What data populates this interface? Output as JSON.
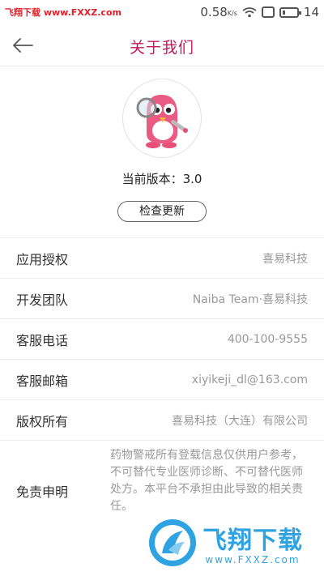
{
  "status_bar": {
    "watermark": "飞翔下载 www.FXXZ.com",
    "speed_value": "0.58",
    "speed_unit": "K/s",
    "time": "14"
  },
  "header": {
    "title": "关于我们"
  },
  "profile": {
    "version_text": "当前版本：3.0",
    "update_button": "检查更新"
  },
  "info": [
    {
      "label": "应用授权",
      "value": "喜易科技"
    },
    {
      "label": "开发团队",
      "value": "Naiba Team·喜易科技"
    },
    {
      "label": "客服电话",
      "value": "400-100-9555"
    },
    {
      "label": "客服邮箱",
      "value": "xiyikeji_dl@163.com"
    },
    {
      "label": "版权所有",
      "value": "喜易科技（大连）有限公司"
    }
  ],
  "disclaimer": {
    "label": "免责申明",
    "text": "药物警戒所有登载信息仅供用户参考，不可替代专业医师诊断、不可替代医师处方。本平台不承担由此导致的相关责任。"
  },
  "watermark_bottom": {
    "name": "飞翔下载",
    "url": "www.FXXZ.com"
  },
  "colors": {
    "title": "#c2185b",
    "accent_pink": "#e8507a",
    "watermark_blue": "#1e9be0"
  }
}
